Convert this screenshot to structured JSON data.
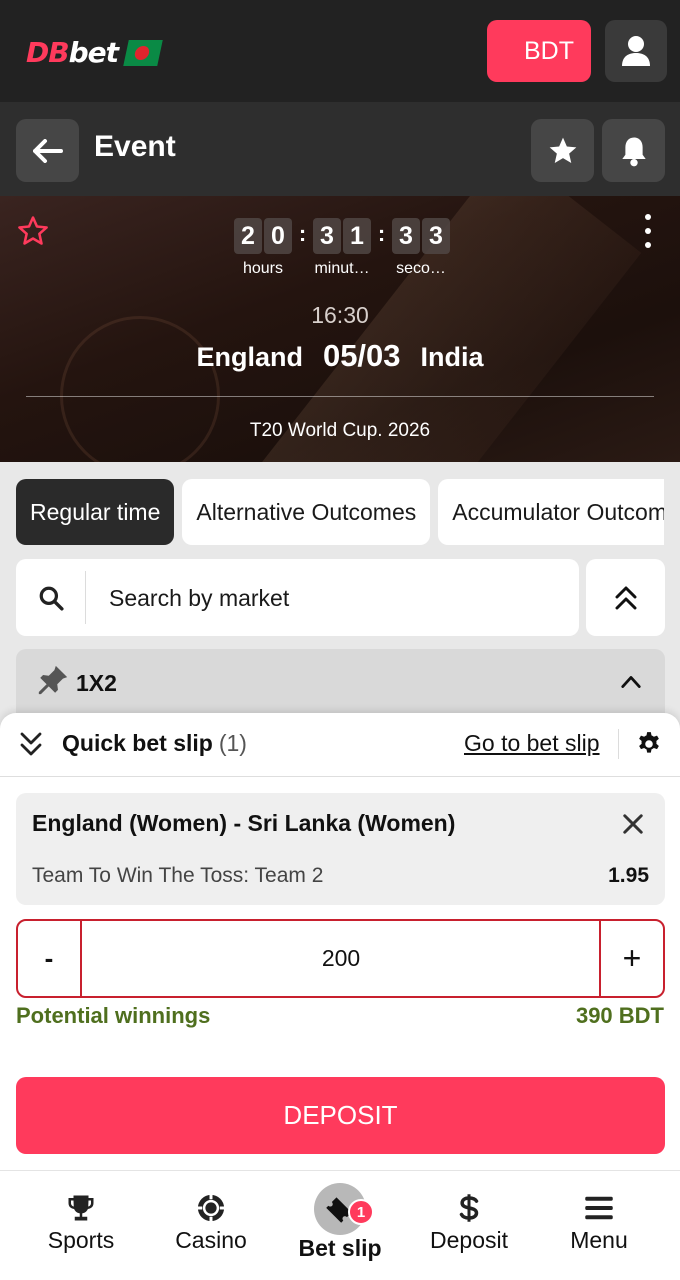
{
  "header": {
    "logo_primary": "DB",
    "logo_secondary": "bet",
    "currency_label": "BDT",
    "brand_color": "#ff3a5c"
  },
  "page": {
    "title": "Event"
  },
  "event": {
    "countdown": {
      "hours": [
        "2",
        "0"
      ],
      "minutes": [
        "3",
        "1"
      ],
      "seconds": [
        "3",
        "3"
      ],
      "hours_label": "hours",
      "minutes_label": "minut…",
      "seconds_label": "seco…"
    },
    "time": "16:30",
    "team_home": "England",
    "date": "05/03",
    "team_away": "India",
    "tournament": "T20 World Cup. 2026"
  },
  "tabs": [
    {
      "label": "Regular time",
      "active": true
    },
    {
      "label": "Alternative Outcomes",
      "active": false
    },
    {
      "label": "Accumulator Outcomes",
      "active": false
    }
  ],
  "search": {
    "placeholder": "Search by market"
  },
  "market": {
    "title": "1X2"
  },
  "quick_bet_slip": {
    "title": "Quick bet slip",
    "count": "(1)",
    "go_to_link": "Go to bet slip",
    "bet": {
      "event": "England (Women) - Sri Lanka (Women)",
      "market": "Team To Win The Toss: Team 2",
      "odds": "1.95"
    },
    "stake": {
      "minus": "-",
      "value": "200",
      "plus": "+"
    },
    "potential_winnings_label": "Potential winnings",
    "potential_winnings_value": "390 BDT",
    "deposit_label": "DEPOSIT"
  },
  "bottom_nav": {
    "sports": "Sports",
    "casino": "Casino",
    "bet_slip": "Bet slip",
    "bet_slip_badge": "1",
    "deposit": "Deposit",
    "menu": "Menu"
  },
  "icons": [
    "user-icon",
    "arrow-left-icon",
    "star-icon",
    "bell-icon",
    "star-outline-icon",
    "more-vertical-icon",
    "search-icon",
    "double-chevron-up-icon",
    "pin-icon",
    "chevron-up-icon",
    "double-chevron-down-icon",
    "gear-icon",
    "close-icon",
    "trophy-icon",
    "casino-chip-icon",
    "ticket-icon",
    "dollar-icon",
    "hamburger-icon"
  ]
}
